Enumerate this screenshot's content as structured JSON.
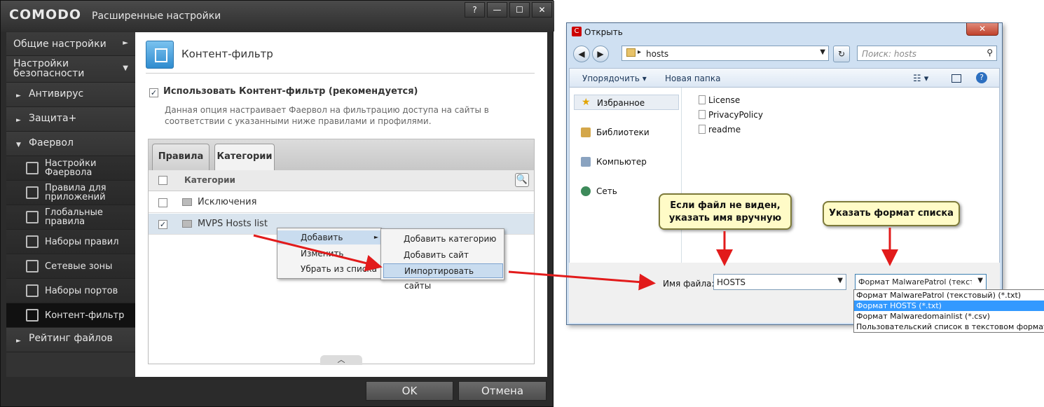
{
  "comodo": {
    "logo": "COMODO",
    "title": "Расширенные настройки",
    "window_buttons": [
      "?",
      "—",
      "☐",
      "✕"
    ],
    "nav": [
      {
        "label": "Общие настройки",
        "arrow": "►"
      },
      {
        "label": "Настройки безопасности",
        "arrow": "▼"
      },
      {
        "label": "Антивирус",
        "marker": "►"
      },
      {
        "label": "Защита+",
        "marker": "►"
      },
      {
        "label": "Фаервол",
        "marker": "▼"
      },
      {
        "label": "Настройки Фаервола"
      },
      {
        "label": "Правила для приложений"
      },
      {
        "label": "Глобальные правила"
      },
      {
        "label": "Наборы правил"
      },
      {
        "label": "Сетевые зоны"
      },
      {
        "label": "Наборы портов"
      },
      {
        "label": "Контент-фильтр"
      },
      {
        "label": "Рейтинг файлов",
        "marker": "►"
      }
    ],
    "section_title": "Контент-фильтр",
    "use_filter_label": "Использовать Контент-фильтр (рекомендуется)",
    "use_filter_checked": true,
    "description": "Данная опция настраивает Фаервол на фильтрацию доступа на сайты в соответствии с указанными ниже правилами и профилями.",
    "tabs": [
      "Правила",
      "Категории"
    ],
    "active_tab": "Категории",
    "categories_header": "Категории",
    "rows": [
      {
        "label": "Исключения",
        "checked": false
      },
      {
        "label": "MVPS Hosts list",
        "checked": true
      }
    ],
    "context_menu": [
      "Добавить",
      "Изменить",
      "Убрать из списка"
    ],
    "submenu": [
      "Добавить категорию",
      "Добавить сайт",
      "Импортировать сайты"
    ],
    "ok_label": "OK",
    "cancel_label": "Отмена",
    "check_mark": "✓",
    "search_glyph": "🔍",
    "grip_glyph": "︿",
    "sub_arrow": "►"
  },
  "dialog": {
    "title": "Открыть",
    "logo": "C",
    "close_glyph": "✕",
    "back_glyph": "◀",
    "forward_glyph": "▶",
    "path_arrow": "▸",
    "address": "hosts",
    "refresh_glyph": "↻",
    "search_placeholder": "Поиск: hosts",
    "search_icon": "search-icon",
    "toolbar_organize": "Упорядочить ▾",
    "toolbar_new_folder": "Новая папка",
    "sidebar": [
      "Избранное",
      "Библиотеки",
      "Компьютер",
      "Сеть"
    ],
    "files": [
      "License",
      "PrivacyPolicy",
      "readme"
    ],
    "filename_label": "Имя файла:",
    "filename_value": "HOSTS",
    "format_selected": "Формат MalwarePatrol (тексто",
    "format_options": [
      "Формат MalwarePatrol (текстовый) (*.txt)",
      "Формат HOSTS (*.txt)",
      "Формат Malwaredomainlist (*.csv)",
      "Пользовательский список в текстовом формате"
    ],
    "format_highlight_index": 1
  },
  "callouts": {
    "left": "Если файл не виден, указать имя вручную",
    "right": "Указать формат списка"
  },
  "colors": {
    "arrow_red": "#e21b1b",
    "highlight": "#3399ff"
  }
}
